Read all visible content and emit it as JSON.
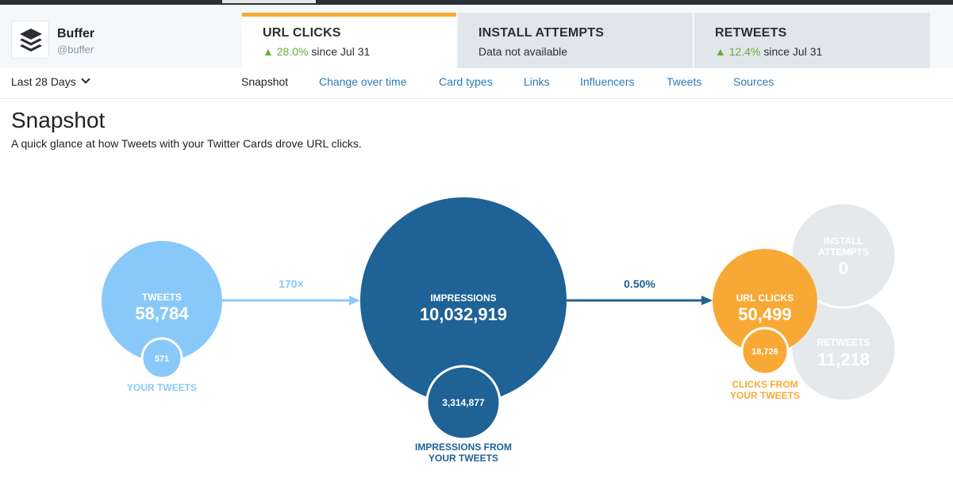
{
  "account": {
    "name": "Buffer",
    "handle": "@buffer"
  },
  "metric_tabs": [
    {
      "title": "URL CLICKS",
      "trend_arrow": "▲",
      "trend_value": "28.0%",
      "trend_suffix": " since Jul 31",
      "active": true
    },
    {
      "title": "INSTALL ATTEMPTS",
      "subtitle": "Data not available",
      "active": false
    },
    {
      "title": "RETWEETS",
      "trend_arrow": "▲",
      "trend_value": "12.4%",
      "trend_suffix": " since Jul 31",
      "active": false
    }
  ],
  "date_range": "Last 28 Days",
  "nav": [
    "Snapshot",
    "Change over time",
    "Card types",
    "Links",
    "Influencers",
    "Tweets",
    "Sources"
  ],
  "nav_active": "Snapshot",
  "page": {
    "title": "Snapshot",
    "description": "A quick glance at how Tweets with your Twitter Cards drove URL clicks."
  },
  "funnel": {
    "tweets": {
      "label": "TWEETS",
      "value": "58,784",
      "sub_value": "571",
      "sub_label": "YOUR TWEETS"
    },
    "ratio_1": "170×",
    "impressions": {
      "label": "IMPRESSIONS",
      "value": "10,032,919",
      "sub_value": "3,314,877",
      "sub_label_line1": "IMPRESSIONS FROM",
      "sub_label_line2": "YOUR TWEETS"
    },
    "ratio_2": "0.50%",
    "url_clicks": {
      "label": "URL CLICKS",
      "value": "50,499",
      "sub_value": "18,726",
      "sub_label_line1": "CLICKS FROM",
      "sub_label_line2": "YOUR TWEETS"
    },
    "install_attempts": {
      "label_line1": "INSTALL",
      "label_line2": "ATTEMPTS",
      "value": "0"
    },
    "retweets": {
      "label": "RETWEETS",
      "value": "11,218"
    }
  },
  "colors": {
    "accent_orange": "#f8a935",
    "light_blue": "#88c9f9",
    "dark_blue": "#1e6296",
    "gray_circle": "#e6e9eb",
    "positive_green": "#66b035",
    "link_blue": "#2b7bb9"
  }
}
